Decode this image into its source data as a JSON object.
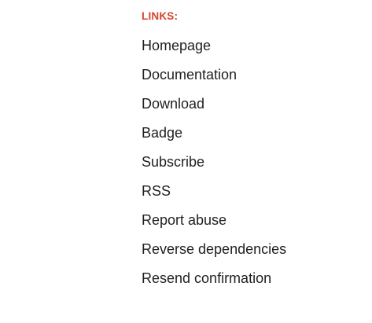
{
  "links": {
    "heading": "LINKS:",
    "items": [
      "Homepage",
      "Documentation",
      "Download",
      "Badge",
      "Subscribe",
      "RSS",
      "Report abuse",
      "Reverse dependencies",
      "Resend confirmation"
    ]
  },
  "colors": {
    "heading": "#d9442c",
    "link_text": "#1f1f1f",
    "background": "#ffffff"
  }
}
